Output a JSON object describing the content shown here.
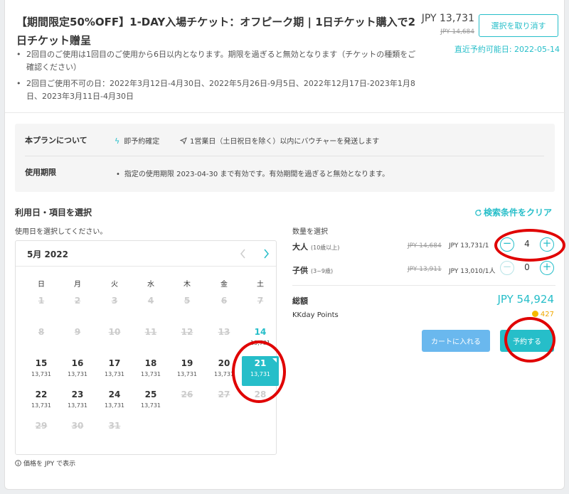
{
  "product": {
    "title": "【期間限定50%OFF】1-DAY入場チケット：オフピーク期 | 1日チケット購入で2日チケット贈呈",
    "notes": [
      "2回目のご使用は1回目のご使用から6日以内となります。期限を過ぎると無効となります（チケットの種類をご確認ください）",
      "2回目ご使用不可の日：2022年3月12日-4月30日、2022年5月26日-9月5日、2022年12月17日-2023年1月8日、2023年3月11日-4月30日"
    ],
    "price": "JPY 13,731",
    "original_price": "JPY 14,684",
    "deselect_label": "選択を取り消す",
    "next_available": "直近予約可能日: 2022-05-14"
  },
  "plan": {
    "about_label": "本プランについて",
    "instant_confirm": "即予約確定",
    "voucher_note": "1営業日（土日祝日を除く）以内にバウチャーを発送します",
    "validity_label": "使用期限",
    "validity_note": "指定の使用期限 2023-04-30 まで有効です。有効期間を過ぎると無効となります。"
  },
  "selection": {
    "title": "利用日・項目を選択",
    "clear_label": "検索条件をクリア",
    "date_hint": "使用日を選択してください。",
    "price_note": "価格を JPY で表示"
  },
  "calendar": {
    "month": "5月 2022",
    "weekdays": [
      "日",
      "月",
      "火",
      "水",
      "木",
      "金",
      "土"
    ],
    "days": [
      {
        "d": "1",
        "p": ""
      },
      {
        "d": "2",
        "p": ""
      },
      {
        "d": "3",
        "p": ""
      },
      {
        "d": "4",
        "p": ""
      },
      {
        "d": "5",
        "p": ""
      },
      {
        "d": "6",
        "p": ""
      },
      {
        "d": "7",
        "p": ""
      },
      {
        "d": "8",
        "p": ""
      },
      {
        "d": "9",
        "p": ""
      },
      {
        "d": "10",
        "p": ""
      },
      {
        "d": "11",
        "p": ""
      },
      {
        "d": "12",
        "p": ""
      },
      {
        "d": "13",
        "p": ""
      },
      {
        "d": "14",
        "p": "13,731"
      },
      {
        "d": "15",
        "p": "13,731"
      },
      {
        "d": "16",
        "p": "13,731"
      },
      {
        "d": "17",
        "p": "13,731"
      },
      {
        "d": "18",
        "p": "13,731"
      },
      {
        "d": "19",
        "p": "13,731"
      },
      {
        "d": "20",
        "p": "13,731"
      },
      {
        "d": "21",
        "p": "13,731"
      },
      {
        "d": "22",
        "p": "13,731"
      },
      {
        "d": "23",
        "p": "13,731"
      },
      {
        "d": "24",
        "p": "13,731"
      },
      {
        "d": "25",
        "p": "13,731"
      },
      {
        "d": "26",
        "p": ""
      },
      {
        "d": "27",
        "p": ""
      },
      {
        "d": "28",
        "p": ""
      },
      {
        "d": "29",
        "p": ""
      },
      {
        "d": "30",
        "p": ""
      },
      {
        "d": "31",
        "p": ""
      }
    ],
    "selected_day": "21"
  },
  "quantity": {
    "title": "数量を選択",
    "adult": {
      "label": "大人",
      "age": "(10歳以上)",
      "original": "JPY 14,684",
      "price": "JPY 13,731/1",
      "count": "4"
    },
    "child": {
      "label": "子供",
      "age": "(3~9歳)",
      "original": "JPY 13,911",
      "price": "JPY 13,010/1人",
      "count": "0"
    }
  },
  "totals": {
    "total_label": "総額",
    "total": "JPY 54,924",
    "points_label": "KKday Points",
    "points": "427"
  },
  "actions": {
    "cart_label": "カートに入れる",
    "book_label": "予約する"
  },
  "colors": {
    "accent": "#26bec9",
    "cart_button": "#6ab8ee",
    "annotation": "#e00000",
    "points": "#f0a800"
  },
  "icons": [
    "bolt-icon",
    "send-icon",
    "refresh-icon",
    "chevron-left-icon",
    "chevron-right-icon",
    "info-icon",
    "coin-icon",
    "minus-icon",
    "plus-icon"
  ]
}
